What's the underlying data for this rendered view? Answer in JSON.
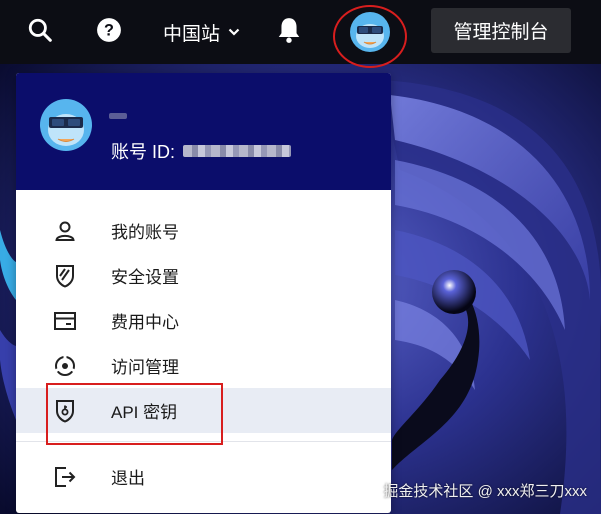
{
  "topbar": {
    "search_icon": "search-icon",
    "help_icon": "help-icon",
    "region_label": "中国站",
    "bell_icon": "bell-icon",
    "console_label": "管理控制台"
  },
  "dropdown": {
    "account_label": "账号 ID:",
    "items": [
      {
        "label": "我的账号",
        "icon": "user-icon"
      },
      {
        "label": "安全设置",
        "icon": "shield-icon"
      },
      {
        "label": "费用中心",
        "icon": "billing-icon"
      },
      {
        "label": "访问管理",
        "icon": "access-icon"
      },
      {
        "label": "API 密钥",
        "icon": "key-badge-icon",
        "active": true
      },
      {
        "label": "退出",
        "icon": "logout-icon"
      }
    ]
  },
  "watermark": "掘金技术社区 @ xxx郑三刀xxx",
  "colors": {
    "topbar_bg": "#0c0d14",
    "header_bg": "#0b0d6b",
    "active_bg": "#e8ecf4",
    "highlight_red": "#d81e1e",
    "console_bg": "#2b2c31"
  }
}
